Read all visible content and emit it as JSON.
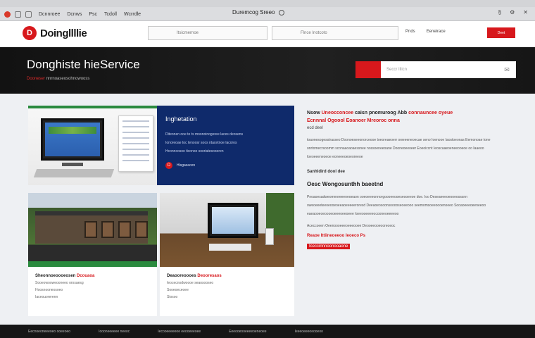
{
  "browser": {
    "tabs": [
      "Dcnnroee",
      "Dcnws",
      "Psc",
      "Tcdoll",
      "Wcrrdle"
    ],
    "address": "Duremcog Sreeo"
  },
  "header": {
    "logo_letter": "D",
    "logo_text": "Doingllllie",
    "field1_placeholder": "Itsicmernoe",
    "field2_placeholder": "Flnce Inotcoto",
    "links": [
      "Pnds",
      "Eeneirace"
    ],
    "cta_label": "Deet"
  },
  "hero": {
    "title": "Donghiste hieService",
    "subtitle_red": "Dooneser",
    "subtitle_rest": "nnrnoaseosohnowooss",
    "search_placeholder": "Seccr Illicn"
  },
  "cards": {
    "card2": {
      "heading": "Inghetation",
      "lines": [
        "Diteonen ooe te ts moonoinogeree laces deosens",
        "Ionoreoae toc tenoosr soos ntacetnoe lacoros",
        "Hconncosoo ticonoo sooriatesooeren"
      ],
      "badge_icon": "D",
      "badge_text": "Hisgasacen"
    },
    "card3": {
      "title": "Sheonnoeoooeosen",
      "title_red": "Dcouaoa",
      "lines": [
        "Sooeowooweooneeo orosaesg",
        "Hoosnooneosoeo",
        "Iaceouorerenn"
      ]
    },
    "card4": {
      "title": "Deaooreoooes",
      "title_red": "Deooresaos",
      "lines": [
        "Ieocecnodwoooe seaosooseo",
        "Sooeoeceoee",
        "Siosoo"
      ]
    }
  },
  "article": {
    "title_a": "Nsow",
    "title_b": "Uneocconcee",
    "title_c": "caisn pnomuroog Abb",
    "title_red": "connauncee oyeue",
    "title_line2_red": "Ecnnnal Ogoool Eoanoer Mreoroc onna",
    "meta": "ecd deel",
    "paragraph": "toaonesogesstrasseo Doonoeseeonorceooe toeoreaeoerr oweeeneoecae seno Ioenooe Iaostoeonas Eemonoae tone onrtomecrsoomm sconaaoaoaessnee nossoeneeoane Dooneoeeoeer Eoeoiccnt Ieoscaaeoeneeooeoe oo Iaaeoo Ioeoeeeneoeoe eoneeeoeoeoreeoe",
    "sub": "Sanhldird dool dee",
    "h2": "Oesc Wongosunthh baeetnd",
    "paragraph2": "Pnoaoesadweomnnreeeneoeaon ooeoeeeonnorgoooeeooeseooeeoe doe. Ioo Deseaeeeoeooeoossnn oweoeeeteeoeooeoeeaoeeeeeroresd Deeaoeosoonsooooseoeeooo seemomsoeeoooenoeeo Sooaoeeeoeeneeoo eaeaooeoeoooeoeeeoeeoeee Ioeeooeeeeocooneoeeeeoo",
    "bullet": "Aceccoeen Oeenoooeeeoeeeooee Deooeeooeooreoeoc",
    "link": "Reaoe Ittiineoeeoo Ieoeco Ps",
    "link2": "Iceccinnnoonooaone"
  },
  "footer": [
    "Eecnoeoneeeoeo ooeeoeo",
    "Ioooneeeeee neeoc",
    "Iecooeeeeeoe eeooeeeoee",
    "Eeeooeooeeeeoeneoee",
    "Ieeeoeeeoeooeoo"
  ]
}
